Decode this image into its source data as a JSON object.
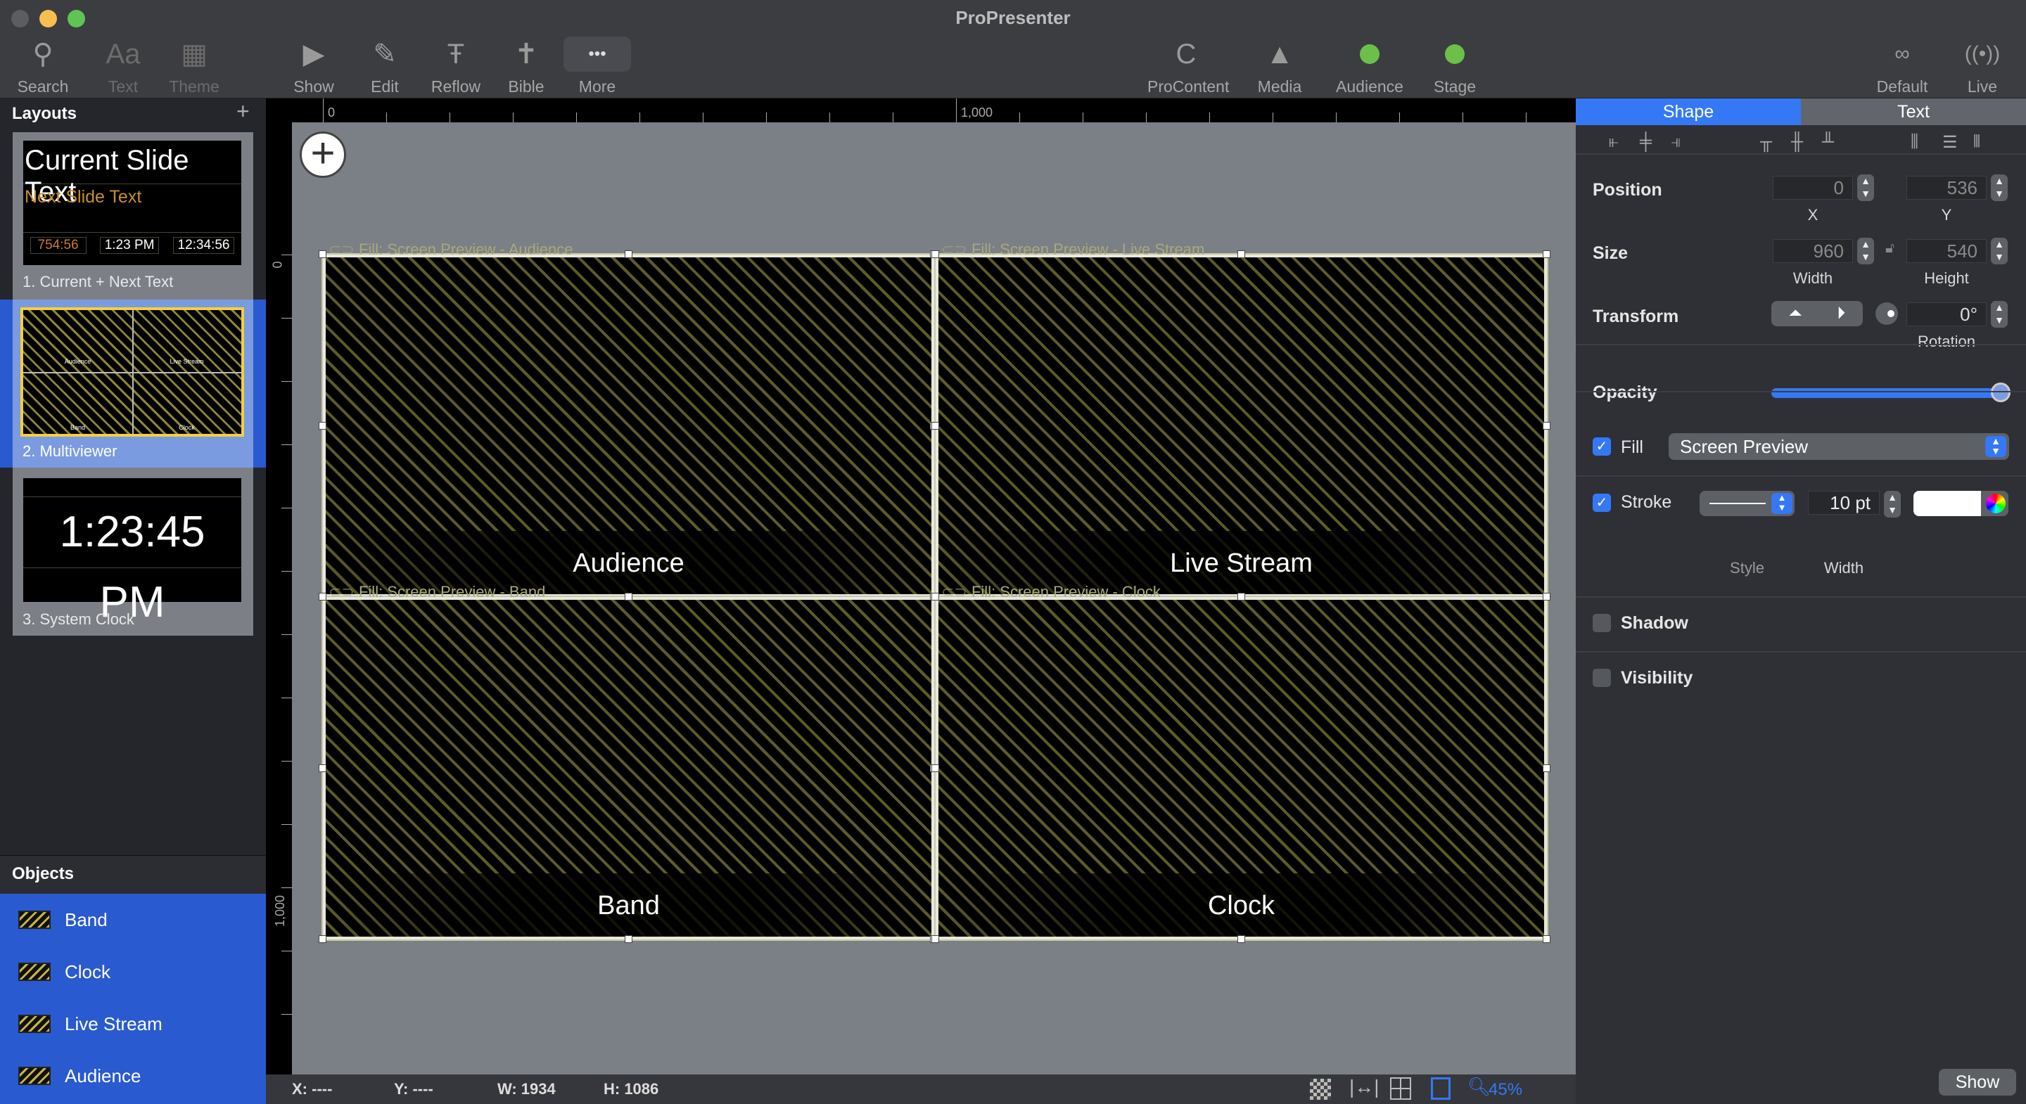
{
  "window": {
    "title": "ProPresenter"
  },
  "toolbar": [
    {
      "label": "Search",
      "icon": "search-icon",
      "glyph": "⚲",
      "dim": false
    },
    {
      "label": "Text",
      "icon": "text-icon",
      "glyph": "Aa",
      "dim": true
    },
    {
      "label": "Theme",
      "icon": "theme-icon",
      "glyph": "▦",
      "dim": true
    },
    {
      "label": "Show",
      "icon": "play-icon",
      "glyph": "▶",
      "dim": false
    },
    {
      "label": "Edit",
      "icon": "pencil-icon",
      "glyph": "✎",
      "dim": false
    },
    {
      "label": "Reflow",
      "icon": "reflow-icon",
      "glyph": "Ŧ",
      "dim": false
    },
    {
      "label": "Bible",
      "icon": "bible-icon",
      "glyph": "✝",
      "dim": false
    },
    {
      "label": "More",
      "icon": "more-icon",
      "glyph": "•••",
      "dim": false
    },
    {
      "label": "ProContent",
      "icon": "procontent-icon",
      "glyph": "C",
      "dim": false
    },
    {
      "label": "Media",
      "icon": "media-icon",
      "glyph": "▲",
      "dim": false
    },
    {
      "label": "Audience",
      "icon": "audience-status-icon",
      "glyph": "",
      "dim": false
    },
    {
      "label": "Stage",
      "icon": "stage-status-icon",
      "glyph": "",
      "dim": false
    },
    {
      "label": "Default",
      "icon": "mustache-icon",
      "glyph": "∞",
      "dim": false
    },
    {
      "label": "Live",
      "icon": "broadcast-icon",
      "glyph": "((•))",
      "dim": false
    }
  ],
  "colors": {
    "accent": "#3478f6",
    "status_green": "#6cc04a",
    "selection": "#2a5ad0",
    "stripe": "#5d5b27",
    "highlight": "#f5cf3a"
  },
  "layouts": {
    "header": "Layouts",
    "add": "+",
    "items": [
      {
        "label": "1.  Current + Next Text",
        "current": "Current Slide Text",
        "next": "Next Slide Text",
        "timer": "754:56",
        "clock": "1:23 PM",
        "countdown": "12:34:56"
      },
      {
        "label": "2.  Multiviewer",
        "selected": true,
        "cells": [
          "Audience",
          "Live Stream",
          "Band",
          "Clock"
        ]
      },
      {
        "label": "3.  System Clock",
        "clock": "1:23:45 PM"
      }
    ]
  },
  "objects": {
    "header": "Objects",
    "items": [
      "Band",
      "Clock",
      "Live Stream",
      "Audience"
    ]
  },
  "rulers": {
    "top": [
      "0",
      "1,000"
    ],
    "left": [
      "0",
      "1,000"
    ]
  },
  "canvas": {
    "frames": [
      {
        "name": "Audience",
        "fill": "Fill: Screen Preview - Audience"
      },
      {
        "name": "Live Stream",
        "fill": "Fill: Screen Preview - Live Stream"
      },
      {
        "name": "Band",
        "fill": "Fill: Screen Preview - Band"
      },
      {
        "name": "Clock",
        "fill": "Fill: Screen Preview - Clock"
      }
    ]
  },
  "status": {
    "x": "X: ----",
    "y": "Y: ----",
    "w": "W: 1934",
    "h": "H: 1086",
    "zoom": "45%"
  },
  "inspector": {
    "tabs": [
      "Shape",
      "Text"
    ],
    "position": {
      "label": "Position",
      "x": "0",
      "y": "536",
      "x_label": "X",
      "y_label": "Y"
    },
    "size": {
      "label": "Size",
      "width": "960",
      "height": "540",
      "w_label": "Width",
      "h_label": "Height"
    },
    "transform": {
      "label": "Transform",
      "rotation": "0°",
      "rot_label": "Rotation"
    },
    "opacity": {
      "label": "Opacity",
      "value": 100
    },
    "fill": {
      "label": "Fill",
      "checked": true,
      "value": "Screen Preview"
    },
    "stroke": {
      "label": "Stroke",
      "checked": true,
      "width": "10 pt",
      "style_label": "Style",
      "width_label": "Width",
      "color": "#ffffff"
    },
    "shadow": {
      "label": "Shadow",
      "checked": false
    },
    "visibility": {
      "label": "Visibility",
      "checked": false
    },
    "show_button": "Show"
  }
}
